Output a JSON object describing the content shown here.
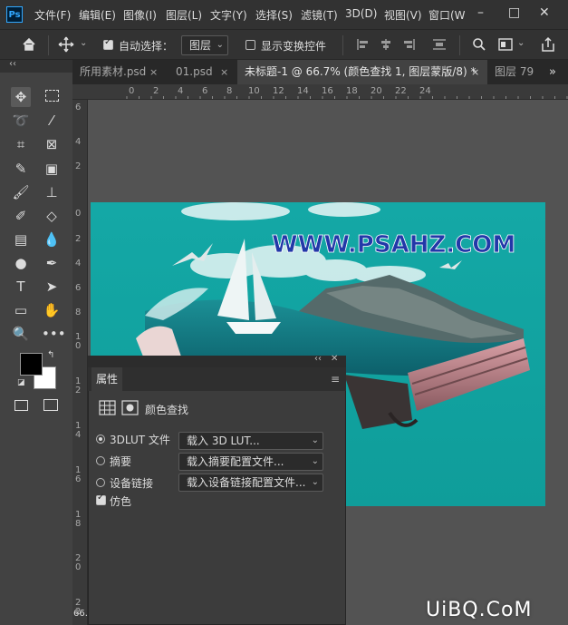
{
  "app": {
    "logo": "Ps"
  },
  "menu": {
    "items": [
      "文件(F)",
      "编辑(E)",
      "图像(I)",
      "图层(L)",
      "文字(Y)",
      "选择(S)",
      "滤镜(T)",
      "3D(D)",
      "视图(V)",
      "窗口(W"
    ],
    "window_buttons": [
      "–",
      "□",
      "✕"
    ]
  },
  "options_bar": {
    "auto_select_label": "自动选择：",
    "auto_select_checked": true,
    "target_value": "图层",
    "show_transform_label": "显示变换控件",
    "show_transform_checked": false
  },
  "tabs": [
    {
      "label": "所用素材.psd",
      "close": "×",
      "active": false
    },
    {
      "label": "01.psd",
      "close": "×",
      "active": false
    },
    {
      "label": "未标题-1 @ 66.7% (颜色查找 1, 图层蒙版/8) *",
      "close": "×",
      "active": true
    },
    {
      "label": "图层 79",
      "close": "",
      "active": false
    }
  ],
  "tab_overflow": "»",
  "toolbar_collapse": "‹‹",
  "ruler": {
    "h": [
      "0",
      "2",
      "4",
      "6",
      "8",
      "10",
      "12",
      "14",
      "16",
      "18",
      "20",
      "22",
      "24"
    ],
    "v": [
      "6",
      "4",
      "2",
      "0",
      "2",
      "4",
      "6",
      "8",
      "1",
      "0",
      "1",
      "2",
      "1",
      "4",
      "1",
      "6",
      "1",
      "8",
      "2",
      "0",
      "2",
      "2"
    ]
  },
  "artwork": {
    "watermark_url": "WWW.PSAHZ.COM",
    "bg_color": "#12a9a6"
  },
  "properties_panel": {
    "title": "属性",
    "subtitle": "颜色查找",
    "options": [
      {
        "label": "3DLUT 文件",
        "checked": true,
        "dropdown": "载入 3D LUT..."
      },
      {
        "label": "摘要",
        "checked": false,
        "dropdown": "载入摘要配置文件..."
      },
      {
        "label": "设备链接",
        "checked": false,
        "dropdown": "载入设备链接配置文件..."
      }
    ],
    "dither_label": "仿色",
    "dither_checked": true,
    "collapse": "‹‹",
    "close": "✕"
  },
  "status": {
    "zoom": "66."
  },
  "watermark_site": "UiBQ.CoM",
  "colors": {
    "accent": "#31a8ff",
    "menubar": "#323232",
    "panel": "#3c3c3c"
  }
}
